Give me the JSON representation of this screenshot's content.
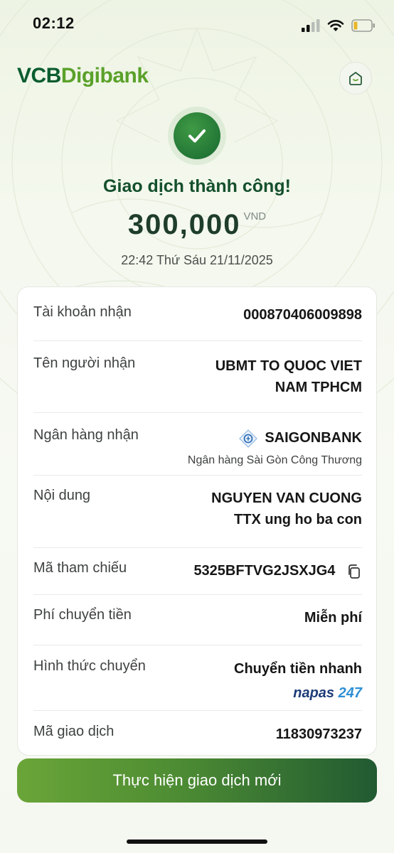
{
  "status_bar": {
    "time": "02:12"
  },
  "header": {
    "brand_part1": "VCB",
    "brand_part2": "Digibank",
    "home_icon": "home-icon"
  },
  "result": {
    "title": "Giao dịch thành công!",
    "amount": "300,000",
    "currency": "VND",
    "datetime": "22:42 Thứ Sáu 21/11/2025"
  },
  "details": {
    "account": {
      "label": "Tài khoản nhận",
      "value": "000870406009898"
    },
    "recipient": {
      "label": "Tên người nhận",
      "value_line1": "UBMT TO QUOC VIET",
      "value_line2": "NAM TPHCM"
    },
    "bank": {
      "label": "Ngân hàng nhận",
      "value": "SAIGONBANK",
      "subvalue": "Ngân hàng Sài Gòn Công Thương"
    },
    "content": {
      "label": "Nội dung",
      "value_line1": "NGUYEN VAN CUONG",
      "value_line2": "TTX ung ho ba con"
    },
    "reference": {
      "label": "Mã tham chiếu",
      "value": "5325BFTVG2JSXJG4",
      "copy_icon": "copy-icon"
    },
    "fee": {
      "label": "Phí chuyển tiền",
      "value": "Miễn phí"
    },
    "method": {
      "label": "Hình thức chuyển",
      "value": "Chuyển tiền nhanh",
      "brand_a": "napas",
      "brand_b": "247"
    },
    "transaction": {
      "label": "Mã giao dịch",
      "value": "11830973237"
    }
  },
  "actions": {
    "new_transaction": "Thực hiện giao dịch mới"
  },
  "colors": {
    "brand_dark": "#0b5c2f",
    "brand_light": "#5aa12a",
    "success": "#17682f"
  }
}
